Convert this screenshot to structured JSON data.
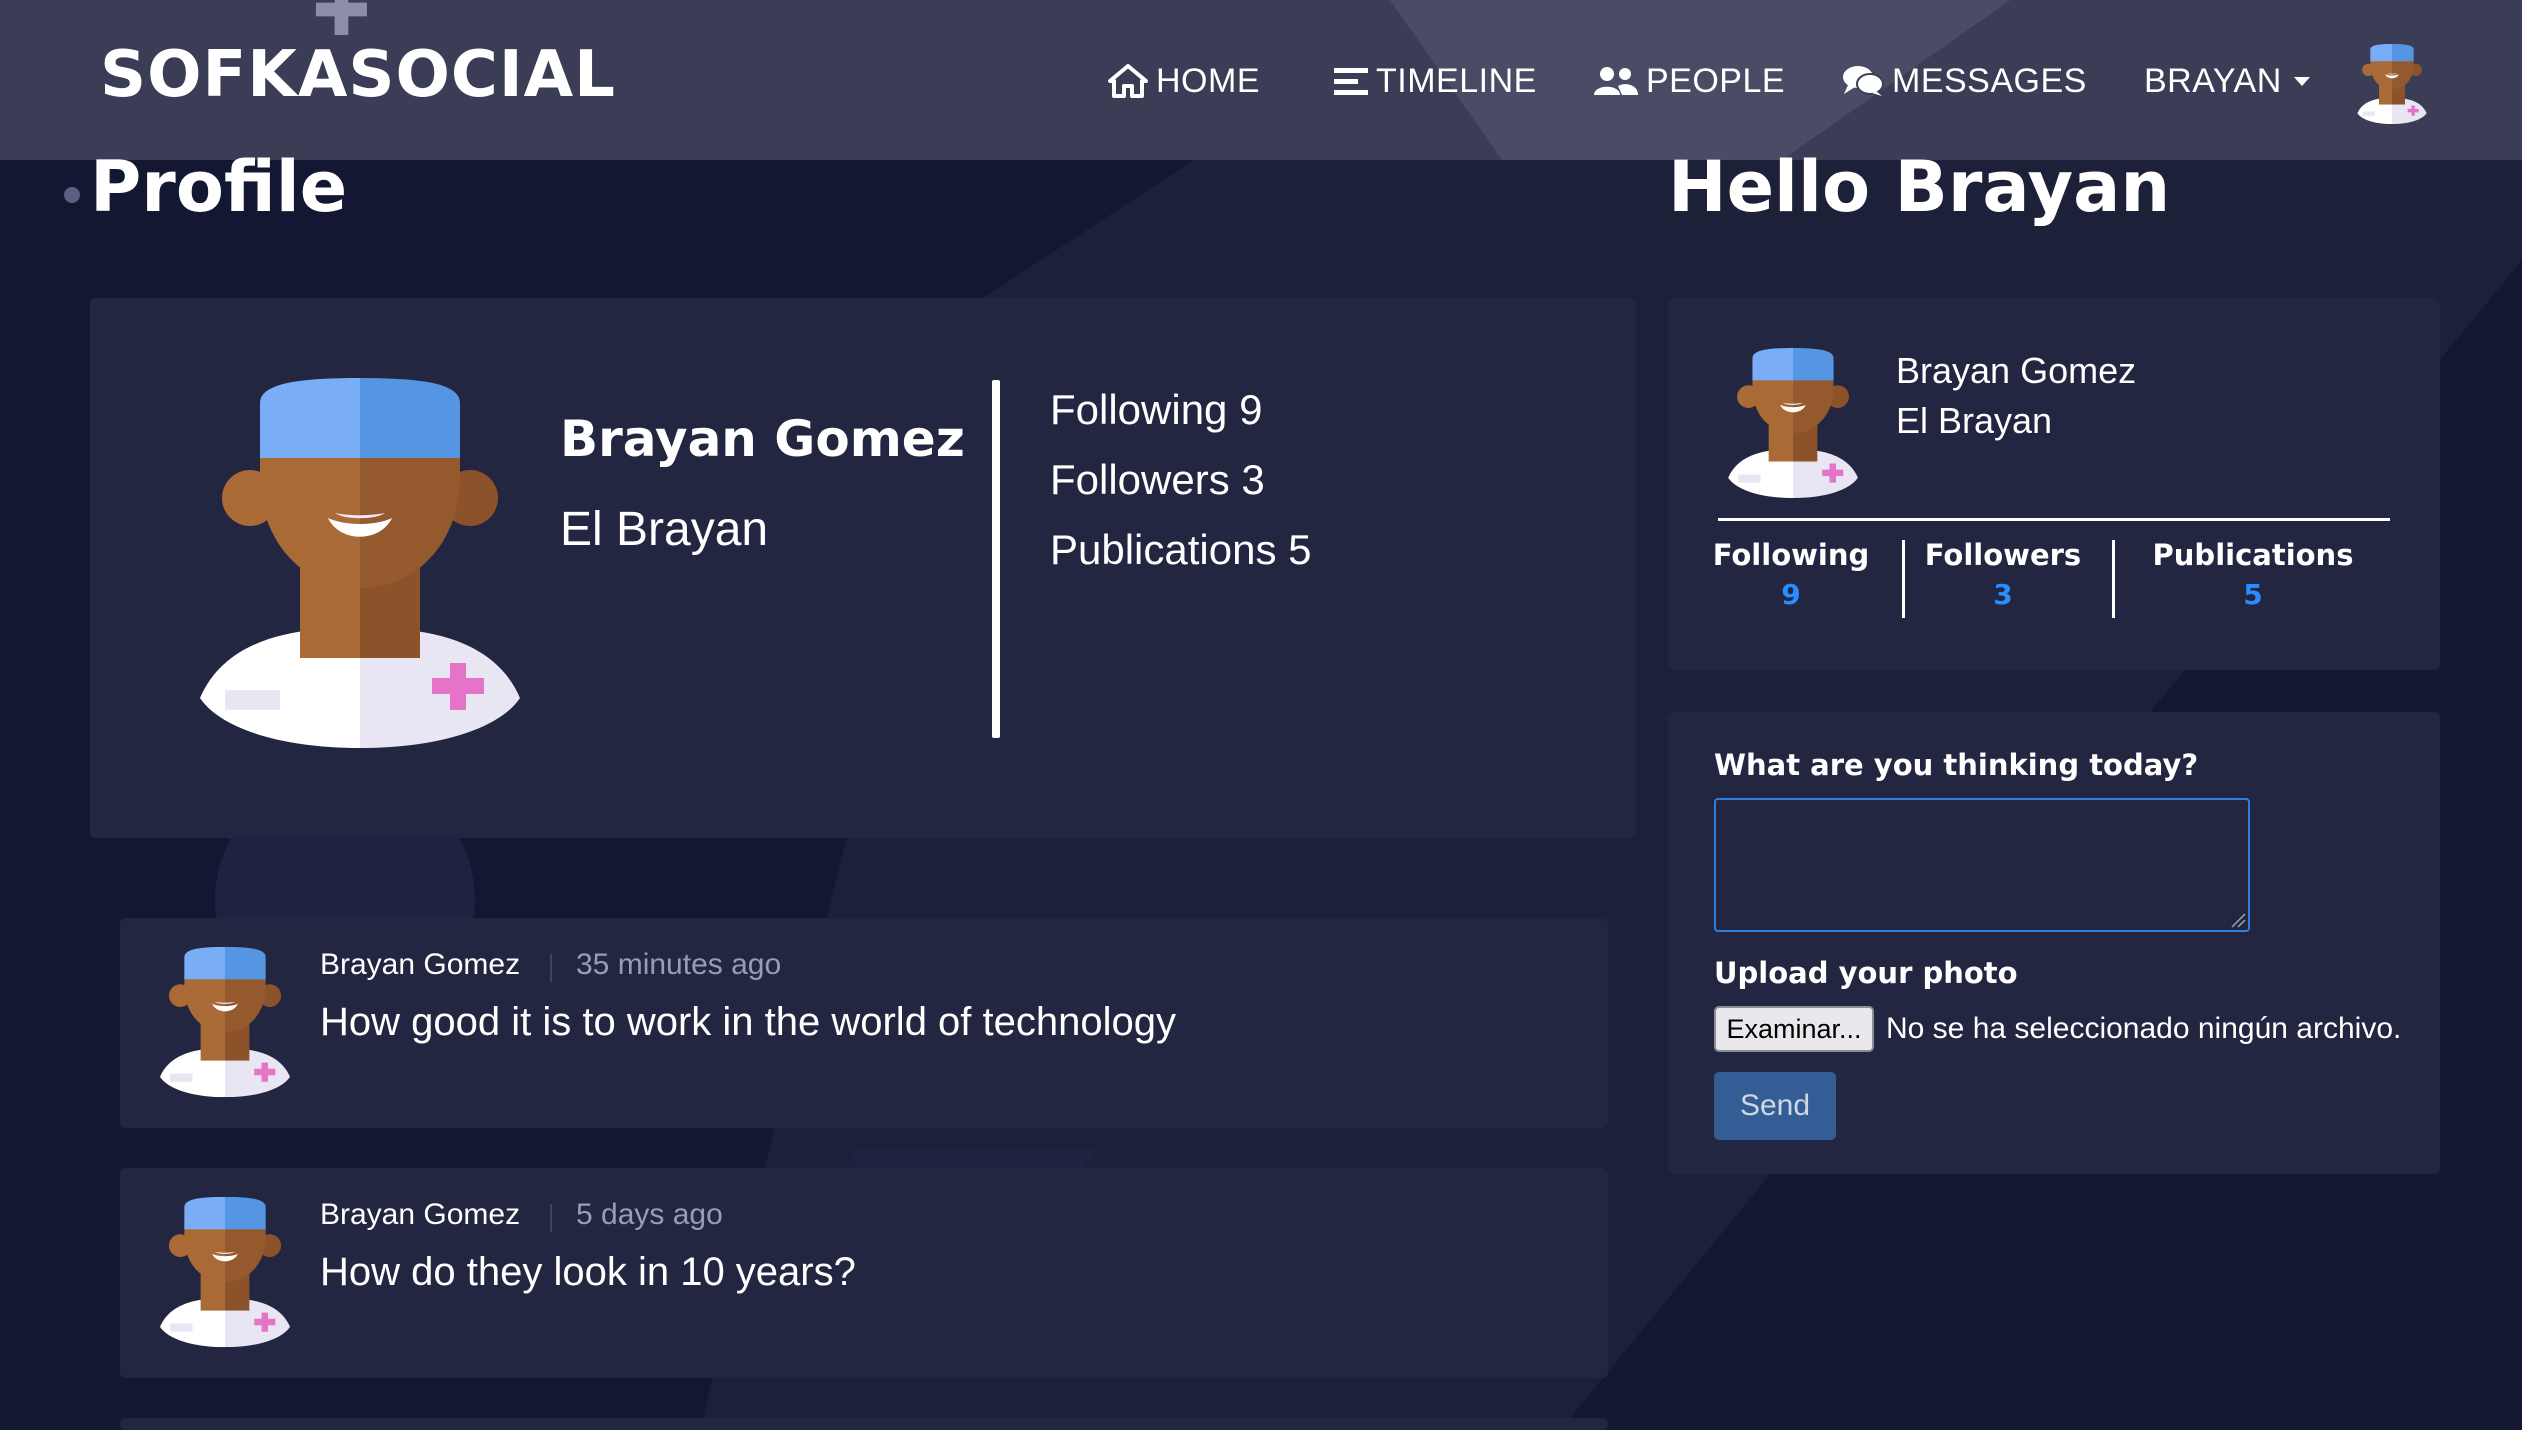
{
  "navbar": {
    "brand": "SOFKASOCIAL",
    "items": [
      {
        "label": "HOME",
        "icon": "home-icon"
      },
      {
        "label": "TIMELINE",
        "icon": "bars-icon"
      },
      {
        "label": "PEOPLE",
        "icon": "users-icon"
      },
      {
        "label": "MESSAGES",
        "icon": "comments-icon"
      }
    ],
    "user_menu": "BRAYAN"
  },
  "headings": {
    "profile": "Profile",
    "hello": "Hello Brayan"
  },
  "profile_card": {
    "name": "Brayan Gomez",
    "nickname": "El Brayan",
    "following": "Following 9",
    "followers": "Followers 3",
    "publications": "Publications 5"
  },
  "info_card": {
    "name": "Brayan Gomez",
    "nickname": "El Brayan",
    "stats": [
      {
        "label": "Following",
        "value": "9"
      },
      {
        "label": "Followers",
        "value": "3"
      },
      {
        "label": "Publications",
        "value": "5"
      }
    ]
  },
  "post_form": {
    "prompt_label": "What are you thinking today?",
    "textarea_value": "",
    "upload_label": "Upload your photo",
    "file_button": "Examinar...",
    "file_status": "No se ha seleccionado ningún archivo.",
    "send_label": "Send"
  },
  "posts": [
    {
      "author": "Brayan Gomez",
      "time": "35 minutes ago",
      "text": "How good it is to work in the world of technology"
    },
    {
      "author": "Brayan Gomez",
      "time": "5 days ago",
      "text": "How do they look in 10 years?"
    }
  ],
  "colors": {
    "background": "#141731",
    "navbar": "#3b3d56",
    "card": "#232640",
    "accent": "#2b8cff",
    "send_button": "#335d94"
  }
}
